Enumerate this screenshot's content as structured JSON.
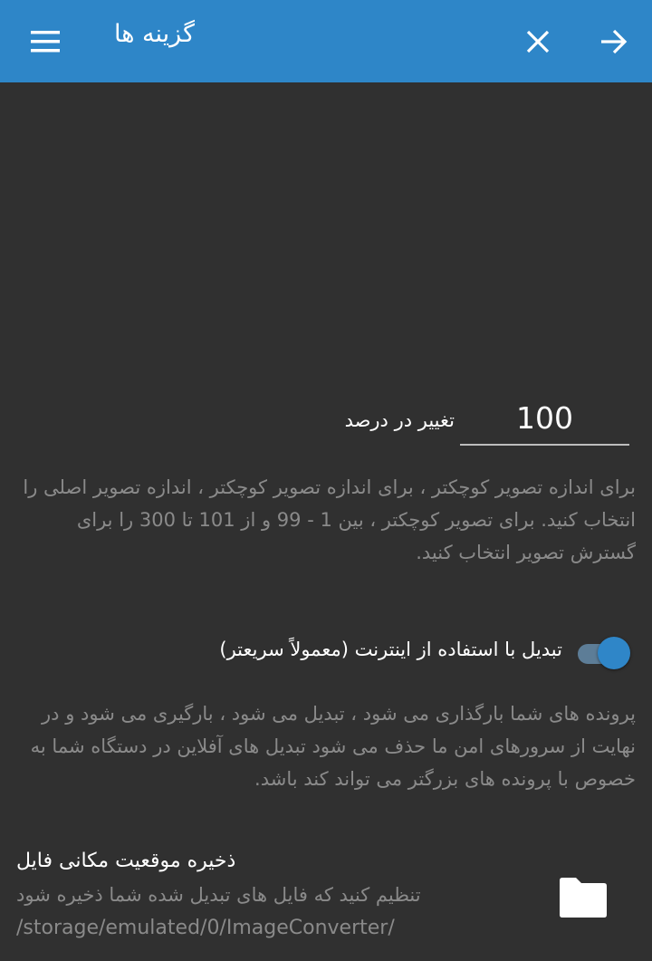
{
  "appbar": {
    "title": "گزینه ها",
    "menu_icon": "menu-icon",
    "close_icon": "close-icon",
    "forward_icon": "arrow-forward-icon",
    "color": "#2e86c8"
  },
  "resize": {
    "value": "100",
    "label": "تغییر در درصد",
    "help": "برای اندازه تصویر کوچکتر ، برای اندازه تصویر کوچکتر ، اندازه تصویر اصلی را انتخاب کنید. برای تصویر کوچکتر ، بین 1 - 99 و از 101 تا 300 را برای گسترش تصویر انتخاب کنید."
  },
  "online_convert": {
    "label": "تبدیل با استفاده از اینترنت (معمولاً سریعتر)",
    "enabled": true,
    "help": "پرونده های شما بارگذاری می شود ، تبدیل می شود ، بارگیری می شود و در نهایت از سرورهای امن ما حذف می شود تبدیل های آفلاین در دستگاه شما به خصوص با پرونده های بزرگتر می تواند کند باشد."
  },
  "save_location": {
    "title": "ذخیره موقعیت مکانی فایل",
    "description": "تنظیم کنید که فایل های تبدیل شده شما ذخیره شود",
    "path": "/storage/emulated/0/ImageConverter/",
    "icon": "folder-icon"
  },
  "colors": {
    "background": "#303030",
    "accent": "#2f86c8",
    "hint_text": "#8a8a8a"
  }
}
